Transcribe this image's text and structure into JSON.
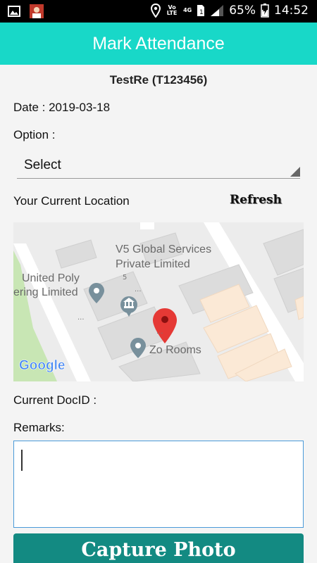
{
  "status_bar": {
    "volte": "Vo LTE",
    "network": "4G",
    "battery_pct": "65%",
    "time": "14:52"
  },
  "app_bar": {
    "title": "Mark Attendance"
  },
  "employee": {
    "name_id": "TestRe (T123456)"
  },
  "date": {
    "label": "Date : 2019-03-18"
  },
  "option": {
    "label": "Option :",
    "selected": "Select"
  },
  "location": {
    "label": "Your Current Location",
    "refresh_label": "Refresh"
  },
  "map": {
    "places": {
      "v5_line1": "V5 Global Services",
      "v5_line2": "Private Limited",
      "united_line1": "United Poly",
      "united_line2": "ering Limited",
      "zo_rooms": "Zo Rooms",
      "number": "5",
      "dots1": "...",
      "dots2": "...",
      "dots3": "..."
    },
    "logo": "Google"
  },
  "doc": {
    "label": "Current DocID :"
  },
  "remarks": {
    "label": "Remarks:",
    "value": ""
  },
  "capture": {
    "label": "Capture Photo"
  },
  "colors": {
    "accent": "#18d8c8",
    "button": "#138a82",
    "input_border": "#4a9ad8",
    "pin": "#e53935"
  }
}
